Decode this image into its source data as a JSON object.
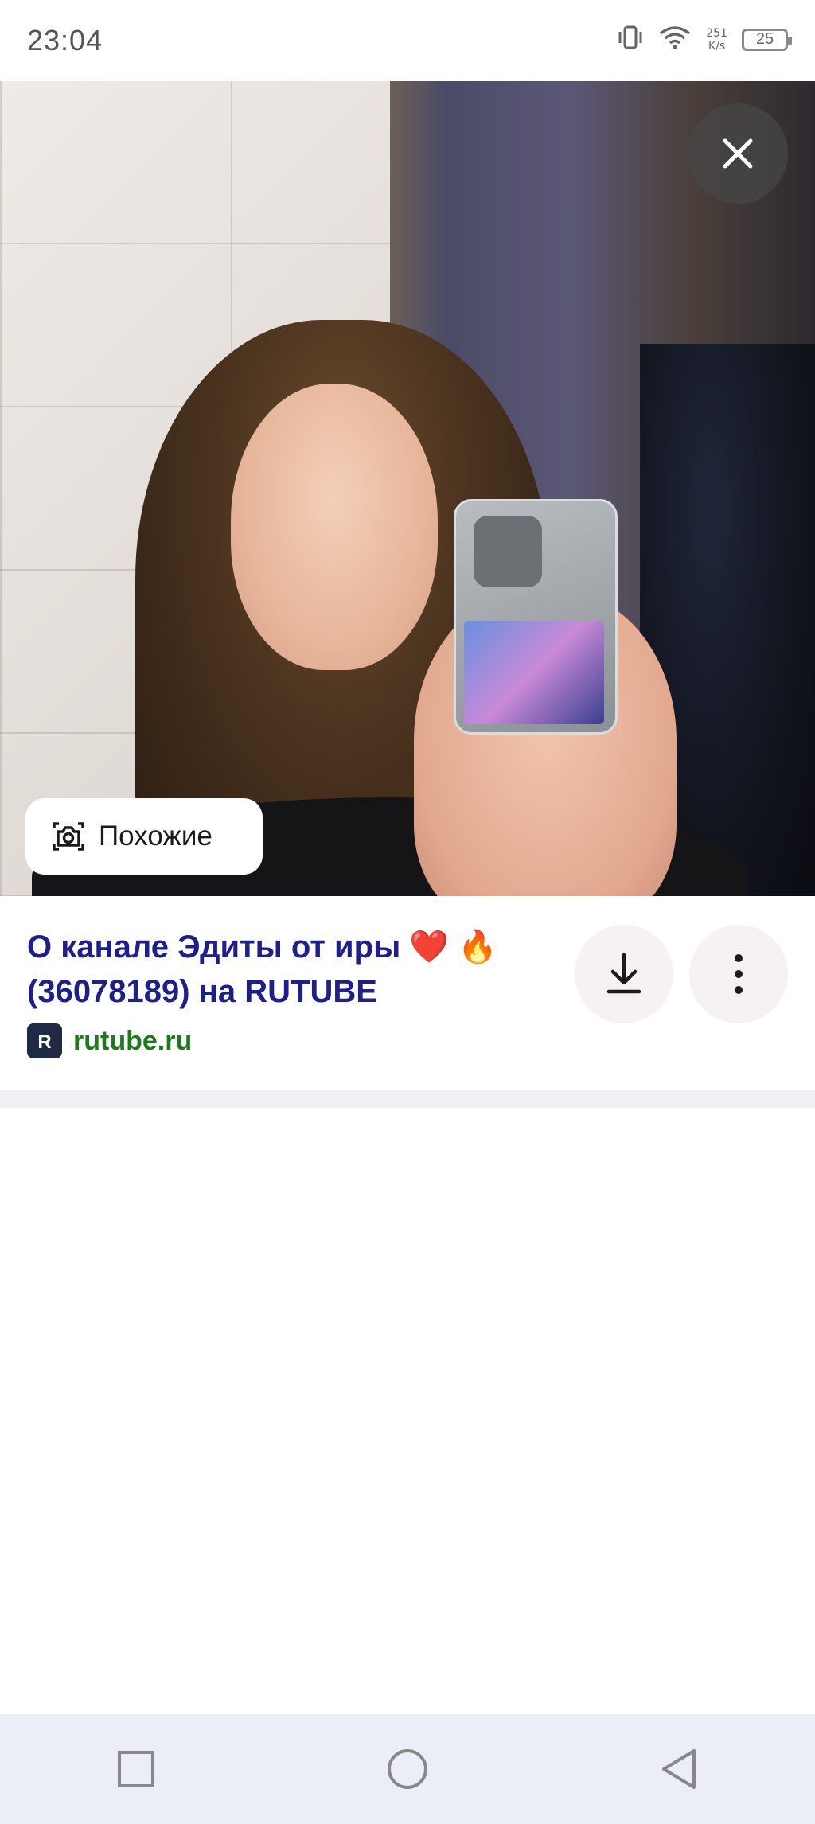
{
  "status_bar": {
    "time": "23:04",
    "net_rate_value": "251",
    "net_rate_unit": "K/s",
    "battery": "25",
    "icons": [
      "vibrate-icon",
      "wifi-icon",
      "battery-icon"
    ]
  },
  "viewer": {
    "close_icon": "close-icon",
    "similar_button": {
      "label": "Похожие",
      "icon": "camera-search-icon"
    }
  },
  "result": {
    "title": "О канале Эдиты от иры ❤️ 🔥 (36078189) на RUTUBE",
    "source": "rutube.ru",
    "source_logo_letter": "R",
    "download_icon": "download-icon",
    "more_icon": "more-vert-icon"
  },
  "nav_bar": {
    "icons": [
      "recents-square-icon",
      "home-circle-icon",
      "back-triangle-icon"
    ]
  },
  "colors": {
    "title": "#1d1f8a",
    "source": "#1a7c1a",
    "navbar_bg": "#eceef7",
    "close_bg": "rgba(70,70,70,.72)"
  }
}
